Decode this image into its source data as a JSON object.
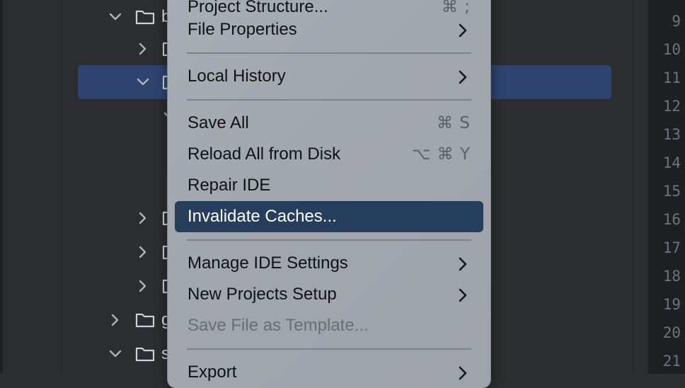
{
  "menu": {
    "items": [
      {
        "label": "Project Structure...",
        "shortcut": "⌘ ;"
      },
      {
        "label": "File Properties"
      },
      {
        "label": "Local History"
      },
      {
        "label": "Save All",
        "shortcut": "⌘ S"
      },
      {
        "label": "Reload All from Disk",
        "shortcut": "⌥ ⌘ Y"
      },
      {
        "label": "Repair IDE"
      },
      {
        "label": "Invalidate Caches..."
      },
      {
        "label": "Manage IDE Settings"
      },
      {
        "label": "New Projects Setup"
      },
      {
        "label": "Save File as Template..."
      },
      {
        "label": "Export"
      }
    ]
  },
  "tree": {
    "visible_labels": [
      "b",
      "g",
      "s"
    ]
  },
  "gutter": {
    "line_numbers": [
      "9",
      "10",
      "11",
      "12",
      "13",
      "14",
      "15",
      "16",
      "17",
      "18",
      "19",
      "20",
      "21"
    ]
  },
  "colors": {
    "background": "#2b2d30",
    "selection": "#2e436e",
    "menu_highlight": "#243e5c",
    "menu_background": "#a4a8af"
  }
}
